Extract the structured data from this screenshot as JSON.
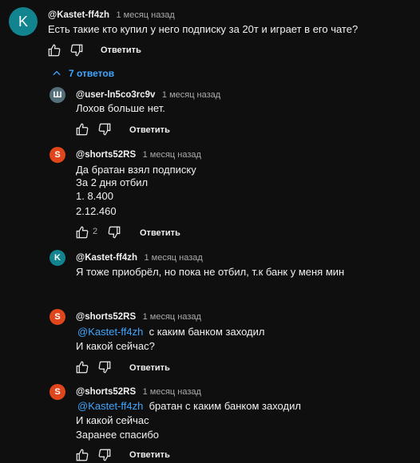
{
  "top_comment": {
    "avatar_letter": "K",
    "avatar_color": "#12848f",
    "author": "@Kastet-ff4zh",
    "time": "1 месяц назад",
    "text": "Есть такие кто купил у него подписку за 20т и играет в его чате?",
    "reply_label": "Ответить"
  },
  "replies_toggle": {
    "label": "7 ответов",
    "icon": "chevron-up-icon"
  },
  "replies": [
    {
      "avatar_letter": "Ш",
      "avatar_color": "#546e7a",
      "author": "@user-ln5co3rc9v",
      "time": "1 месяц назад",
      "lines": [
        "Лохов больше нет."
      ],
      "reply_label": "Ответить"
    },
    {
      "avatar_letter": "S",
      "avatar_color": "#e0451b",
      "author": "@shorts52RS",
      "time": "1 месяц назад",
      "lines": [
        "Да братан взял подписку",
        "За 2 дня отбил",
        "1. 8.400",
        "2.12.460"
      ],
      "like_count": "2",
      "reply_label": "Ответить"
    },
    {
      "avatar_letter": "K",
      "avatar_color": "#12848f",
      "author": "@Kastet-ff4zh",
      "time": "1 месяц назад",
      "lines": [
        "Я тоже приобрёл, но пока не отбил, т.к банк у меня мин"
      ],
      "reply_label": "Ответить"
    },
    {
      "avatar_letter": "S",
      "avatar_color": "#e0451b",
      "author": "@shorts52RS",
      "time": "1 месяц назад",
      "mention": "@Kastet-ff4zh",
      "lines": [
        "с каким банком заходил",
        "И какой сейчас?"
      ],
      "reply_label": "Ответить"
    },
    {
      "avatar_letter": "S",
      "avatar_color": "#e0451b",
      "author": "@shorts52RS",
      "time": "1 месяц назад",
      "mention": "@Kastet-ff4zh",
      "lines": [
        "братан с каким банком заходил",
        "И какой сейчас",
        "Заранее спасибо"
      ],
      "reply_label": "Ответить"
    }
  ]
}
